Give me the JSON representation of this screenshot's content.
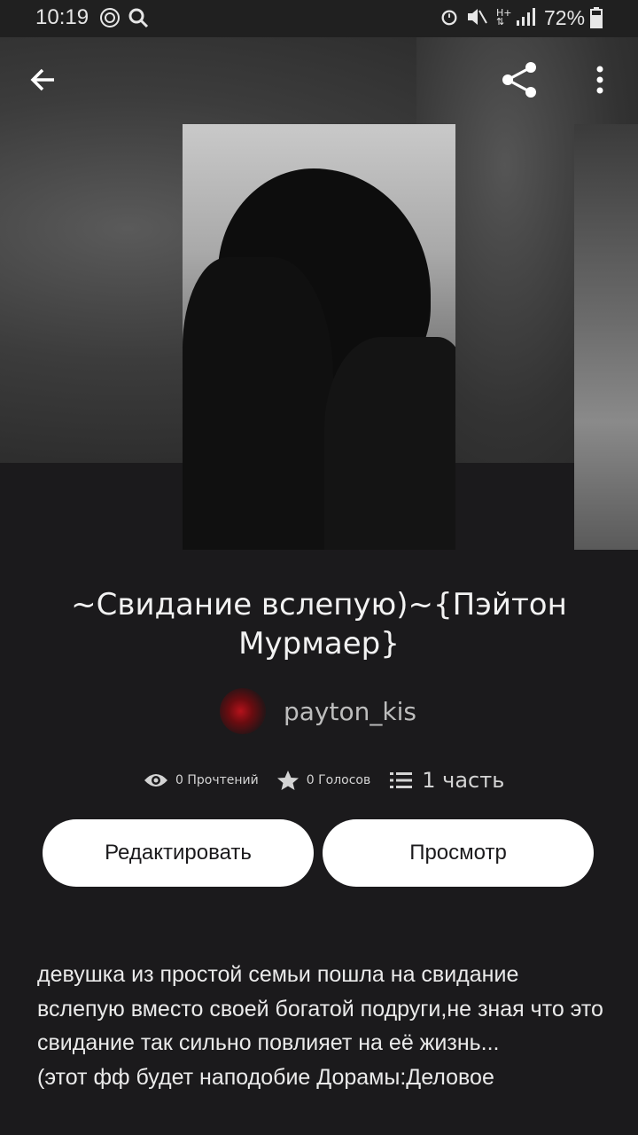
{
  "status_bar": {
    "time": "10:19",
    "battery": "72%"
  },
  "story": {
    "title": "~Свидание вслепую)~{Пэйтон Мурмаер}",
    "author": "payton_kis",
    "reads": "0 Прочтений",
    "votes": "0 Голосов",
    "parts": "1 часть"
  },
  "actions": {
    "edit_label": "Редактировать",
    "preview_label": "Просмотр"
  },
  "description": "девушка из простой семьи пошла на свидание вслепую вместо своей богатой подруги,не зная что это свидание так сильно повлияет на её жизнь...\n(этот фф будет наподобие Дорамы:Деловое",
  "icons": {
    "back": "arrow-left-icon",
    "share": "share-icon",
    "more": "more-vertical-icon",
    "reads": "eye-icon",
    "votes": "star-icon",
    "parts": "list-icon"
  }
}
